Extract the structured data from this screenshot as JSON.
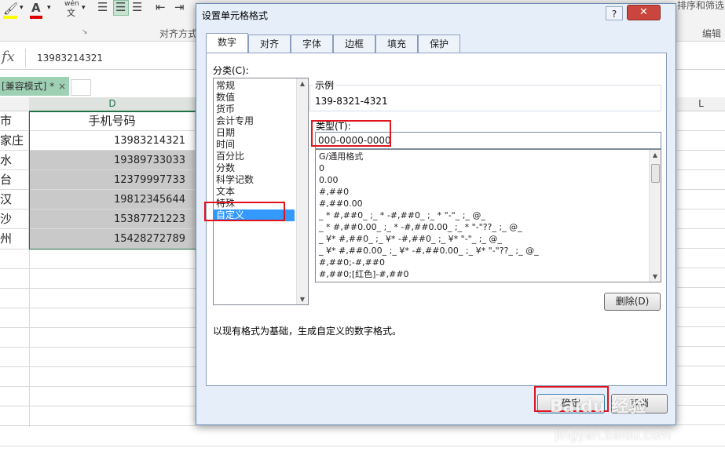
{
  "excel": {
    "ribbon": {
      "pinyin_label": "wén",
      "pinyin_char": "文",
      "align_group_label": "对齐方式",
      "edit_group_label": "编辑",
      "sort_filter_label": "排序和筛选"
    },
    "fx_label": "fx",
    "formula_value": "13983214321",
    "doc_tab": "[兼容模式] *",
    "doc_tab_close": "×",
    "col_d": "D",
    "col_l": "L",
    "col_header_cell": "手机号码",
    "left_partial": [
      "市",
      "家庄",
      "水",
      "台",
      "汉",
      "沙",
      "州"
    ],
    "phones": [
      "13983214321",
      "19389733033",
      "12379997733",
      "19812345644",
      "15387721223",
      "15428272789"
    ]
  },
  "dialog": {
    "title": "设置单元格格式",
    "help": "?",
    "close": "✕",
    "tabs": [
      "数字",
      "对齐",
      "字体",
      "边框",
      "填充",
      "保护"
    ],
    "category_label": "分类(C):",
    "categories": [
      "常规",
      "数值",
      "货币",
      "会计专用",
      "日期",
      "时间",
      "百分比",
      "分数",
      "科学记数",
      "文本",
      "特殊",
      "自定义"
    ],
    "selected_category": "自定义",
    "sample_label": "示例",
    "sample_value": "139-8321-4321",
    "type_label": "类型(T):",
    "type_value": "000-0000-0000",
    "formats": [
      "G/通用格式",
      "0",
      "0.00",
      "#,##0",
      "#,##0.00",
      "_ * #,##0_ ;_ * -#,##0_ ;_ * \"-\"_ ;_ @_",
      "_ * #,##0.00_ ;_ * -#,##0.00_ ;_ * \"-\"??_ ;_ @_",
      "_ ¥* #,##0_ ;_ ¥* -#,##0_ ;_ ¥* \"-\"_ ;_ @_",
      "_ ¥* #,##0.00_ ;_ ¥* -#,##0.00_ ;_ ¥* \"-\"??_ ;_ @_",
      "#,##0;-#,##0",
      "#,##0;[红色]-#,##0"
    ],
    "delete_button": "删除(D)",
    "description": "以现有格式为基础，生成自定义的数字格式。",
    "ok_button": "确定",
    "cancel_button": "取消"
  },
  "watermark": {
    "brand": "Baidu 经验",
    "url": "jingyan.baidu.com"
  },
  "colors": {
    "accent_red": "#e0141e",
    "selection_blue": "#3399ff",
    "doc_tab_green": "#9ed0b4",
    "cell_gray": "#c9c9c9",
    "header_green": "#217346"
  }
}
